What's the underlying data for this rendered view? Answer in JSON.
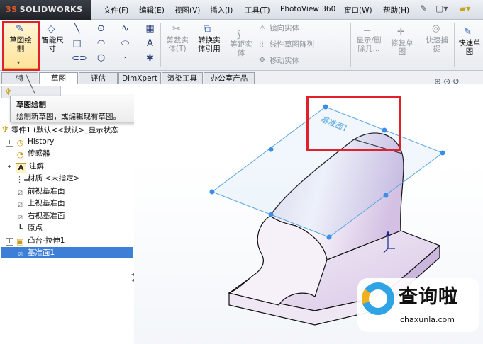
{
  "app": {
    "brand": "SOLIDWORKS",
    "brand_mark": "3S"
  },
  "menu": [
    "文件(F)",
    "编辑(E)",
    "视图(V)",
    "插入(I)",
    "工具(T)",
    "PhotoView 360",
    "窗口(W)",
    "帮助(H)"
  ],
  "ribbon": {
    "sketch": "草图绘\n制",
    "smart_dim": "智能尺\n寸",
    "trim": "剪裁实\n体(T)",
    "convert": "转换实\n体引用",
    "offset": "等距实\n体",
    "mirror": "镜向实体",
    "pattern": "线性草图阵列",
    "move": "移动实体",
    "display_delete": "显示/删\n除几...",
    "repair": "修复草\n图",
    "quick_snap": "快速捕\n捉",
    "quick_sketch": "快速草\n图"
  },
  "tabs": [
    "特",
    "草图",
    "评估",
    "DimXpert",
    "渲染工具",
    "办公室产品"
  ],
  "tooltip": {
    "title": "草图绘制",
    "desc": "绘制新草图，或编辑现有草图。"
  },
  "tree": {
    "root": "零件1 (默认<<默认>_显示状态",
    "items": [
      "History",
      "传感器",
      "注解",
      "材质 <未指定>",
      "前视基准面",
      "上视基准面",
      "右视基准面",
      "原点",
      "凸台-拉伸1",
      "基准面1"
    ]
  },
  "viewport": {
    "plane_label": "基准面1"
  },
  "watermark": {
    "name": "查询啦",
    "url": "chaxunla.com"
  },
  "colors": {
    "accent": "#3a8ee6",
    "highlight": "#e0202a",
    "plane": "#5aa6e0",
    "selection": "#3d7fd6"
  }
}
